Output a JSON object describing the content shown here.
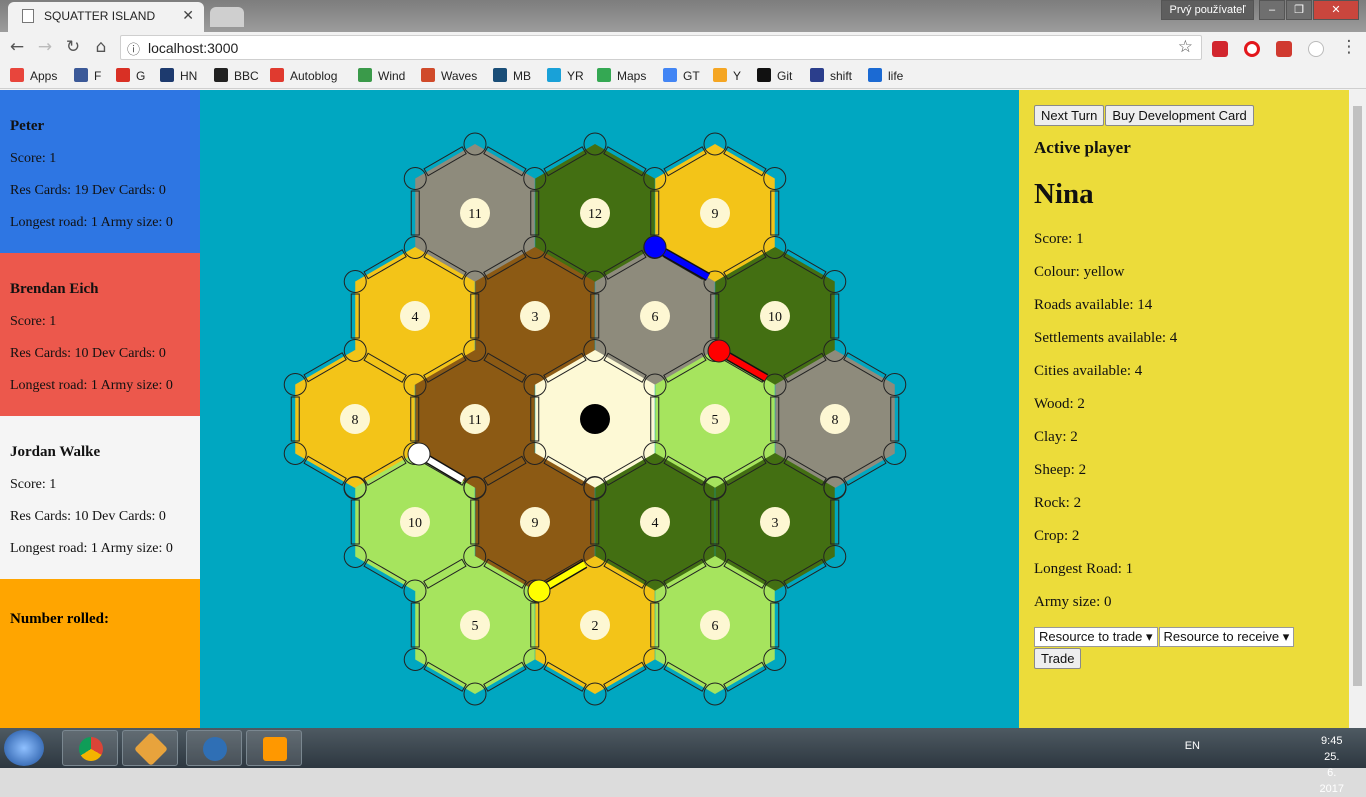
{
  "browser": {
    "tab_title": "SQUATTER ISLAND",
    "user_button": "Prvý používateľ",
    "url": "localhost:3000",
    "bookmarks": [
      {
        "label": "Apps",
        "color": "#e8453c"
      },
      {
        "label": "F",
        "color": "#3b5998"
      },
      {
        "label": "G",
        "color": "#d93025"
      },
      {
        "label": "HN",
        "color": "#1d3a6e"
      },
      {
        "label": "BBC",
        "color": "#222222"
      },
      {
        "label": "Autoblog",
        "color": "#e03a2f"
      },
      {
        "label": "Wind",
        "color": "#3a9a4a"
      },
      {
        "label": "Waves",
        "color": "#d04a2a"
      },
      {
        "label": "MB",
        "color": "#1a4e78"
      },
      {
        "label": "YR",
        "color": "#19a1d8"
      },
      {
        "label": "Maps",
        "color": "#34a853"
      },
      {
        "label": "GT",
        "color": "#4285f4"
      },
      {
        "label": "Y",
        "color": "#f5a623"
      },
      {
        "label": "Git",
        "color": "#111111"
      },
      {
        "label": "shift",
        "color": "#2b3e8c"
      },
      {
        "label": "life",
        "color": "#1b6ad3"
      }
    ]
  },
  "players": [
    {
      "name": "Peter",
      "score": "Score: 1",
      "cards": "Res Cards: 19 Dev Cards: 0",
      "road_army": "Longest road: 1 Army size: 0",
      "color": "#2e76e3"
    },
    {
      "name": "Brendan Eich",
      "score": "Score: 1",
      "cards": "Res Cards: 10 Dev Cards: 0",
      "road_army": "Longest road: 1 Army size: 0",
      "color": "#ec584c"
    },
    {
      "name": "Jordan Walke",
      "score": "Score: 1",
      "cards": "Res Cards: 10 Dev Cards: 0",
      "road_army": "Longest road: 1 Army size: 0",
      "color": "#f5f5f5"
    }
  ],
  "rolled": {
    "label": "Number rolled:"
  },
  "board": {
    "tiles": [
      {
        "row": 0,
        "col": 0,
        "type": "rock",
        "number": "11"
      },
      {
        "row": 0,
        "col": 1,
        "type": "wood",
        "number": "12"
      },
      {
        "row": 0,
        "col": 2,
        "type": "crop",
        "number": "9"
      },
      {
        "row": 1,
        "col": 0,
        "type": "crop",
        "number": "4"
      },
      {
        "row": 1,
        "col": 1,
        "type": "clay",
        "number": "3"
      },
      {
        "row": 1,
        "col": 2,
        "type": "rock",
        "number": "6"
      },
      {
        "row": 1,
        "col": 3,
        "type": "wood",
        "number": "10"
      },
      {
        "row": 2,
        "col": 0,
        "type": "crop",
        "number": "8"
      },
      {
        "row": 2,
        "col": 1,
        "type": "clay",
        "number": "11"
      },
      {
        "row": 2,
        "col": 2,
        "type": "desert",
        "number": ""
      },
      {
        "row": 2,
        "col": 3,
        "type": "sheep",
        "number": "5"
      },
      {
        "row": 2,
        "col": 4,
        "type": "rock",
        "number": "8"
      },
      {
        "row": 3,
        "col": 0,
        "type": "sheep",
        "number": "10"
      },
      {
        "row": 3,
        "col": 1,
        "type": "clay",
        "number": "9"
      },
      {
        "row": 3,
        "col": 2,
        "type": "wood",
        "number": "4"
      },
      {
        "row": 3,
        "col": 3,
        "type": "wood",
        "number": "3"
      },
      {
        "row": 4,
        "col": 0,
        "type": "sheep",
        "number": "5"
      },
      {
        "row": 4,
        "col": 1,
        "type": "crop",
        "number": "2"
      },
      {
        "row": 4,
        "col": 2,
        "type": "sheep",
        "number": "6"
      }
    ],
    "colors": {
      "rock": "#8e8b7c",
      "wood": "#436f12",
      "crop": "#f3c418",
      "clay": "#8c5a14",
      "sheep": "#a6e45e",
      "desert": "#fdf9d5",
      "token": "#fdf7d3",
      "sea": "#00a7c1"
    },
    "settlements": [
      {
        "owner": "blue",
        "color": "#0000ff"
      },
      {
        "owner": "red",
        "color": "#ff0000"
      },
      {
        "owner": "white",
        "color": "#ffffff"
      },
      {
        "owner": "yellow",
        "color": "#ffff00"
      }
    ],
    "robber": "desert"
  },
  "side": {
    "next_turn": "Next Turn",
    "buy_dev": "Buy Development Card",
    "active_heading": "Active player",
    "active_name": "Nina",
    "stats": [
      "Score: 1",
      "Colour: yellow",
      "Roads available: 14",
      "Settlements available: 4",
      "Cities available: 4",
      "Wood: 2",
      "Clay: 2",
      "Sheep: 2",
      "Rock: 2",
      "Crop: 2",
      "Longest Road: 1",
      "Army size: 0"
    ],
    "trade_give": "Resource to trade",
    "trade_receive": "Resource to receive",
    "trade_button": "Trade"
  },
  "taskbar": {
    "lang": "EN",
    "time": "9:45",
    "date": "25. 6. 2017"
  }
}
